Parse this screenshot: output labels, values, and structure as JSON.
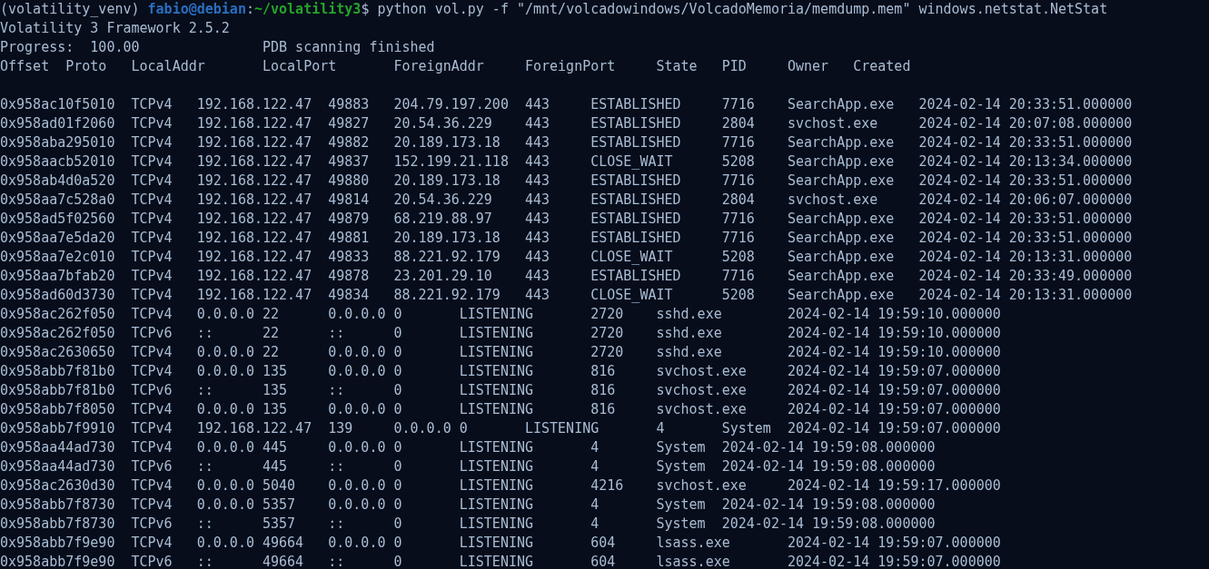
{
  "prompt": {
    "venv": "(volatility_venv)",
    "user_host": "fabio@debian",
    "separator": ":",
    "path": "~/volatility3",
    "command": "$ python vol.py -f \"/mnt/volcadowindows/VolcadoMemoria/memdump.mem\" windows.netstat.NetStat"
  },
  "output_lines": [
    {
      "text": "Volatility 3 Framework 2.5.2"
    },
    {
      "text": "Progress:  100.00\t\tPDB scanning finished"
    }
  ],
  "header_words": [
    "Offset",
    "Proto",
    "LocalAddr",
    "LocalPort",
    "ForeignAddr",
    "ForeignPort",
    "State",
    "PID",
    "Owner",
    "Created"
  ],
  "netstat": {
    "rows": [
      [
        "0x958ac10f5010",
        "TCPv4",
        "192.168.122.47",
        "49883",
        "204.79.197.200",
        "443",
        "ESTABLISHED",
        "7716",
        "SearchApp.exe",
        "2024-02-14 20:33:51.000000"
      ],
      [
        "0x958ad01f2060",
        "TCPv4",
        "192.168.122.47",
        "49827",
        "20.54.36.229",
        "443",
        "ESTABLISHED",
        "2804",
        "svchost.exe",
        "2024-02-14 20:07:08.000000"
      ],
      [
        "0x958aba295010",
        "TCPv4",
        "192.168.122.47",
        "49882",
        "20.189.173.18",
        "443",
        "ESTABLISHED",
        "7716",
        "SearchApp.exe",
        "2024-02-14 20:33:51.000000"
      ],
      [
        "0x958aacb52010",
        "TCPv4",
        "192.168.122.47",
        "49837",
        "152.199.21.118",
        "443",
        "CLOSE_WAIT",
        "5208",
        "SearchApp.exe",
        "2024-02-14 20:13:34.000000"
      ],
      [
        "0x958ab4d0a520",
        "TCPv4",
        "192.168.122.47",
        "49880",
        "20.189.173.18",
        "443",
        "ESTABLISHED",
        "7716",
        "SearchApp.exe",
        "2024-02-14 20:33:51.000000"
      ],
      [
        "0x958aa7c528a0",
        "TCPv4",
        "192.168.122.47",
        "49814",
        "20.54.36.229",
        "443",
        "ESTABLISHED",
        "2804",
        "svchost.exe",
        "2024-02-14 20:06:07.000000"
      ],
      [
        "0x958ad5f02560",
        "TCPv4",
        "192.168.122.47",
        "49879",
        "68.219.88.97",
        "443",
        "ESTABLISHED",
        "7716",
        "SearchApp.exe",
        "2024-02-14 20:33:51.000000"
      ],
      [
        "0x958aa7e5da20",
        "TCPv4",
        "192.168.122.47",
        "49881",
        "20.189.173.18",
        "443",
        "ESTABLISHED",
        "7716",
        "SearchApp.exe",
        "2024-02-14 20:33:51.000000"
      ],
      [
        "0x958aa7e2c010",
        "TCPv4",
        "192.168.122.47",
        "49833",
        "88.221.92.179",
        "443",
        "CLOSE_WAIT",
        "5208",
        "SearchApp.exe",
        "2024-02-14 20:13:31.000000"
      ],
      [
        "0x958aa7bfab20",
        "TCPv4",
        "192.168.122.47",
        "49878",
        "23.201.29.10",
        "443",
        "ESTABLISHED",
        "7716",
        "SearchApp.exe",
        "2024-02-14 20:33:49.000000"
      ],
      [
        "0x958ad60d3730",
        "TCPv4",
        "192.168.122.47",
        "49834",
        "88.221.92.179",
        "443",
        "CLOSE_WAIT",
        "5208",
        "SearchApp.exe",
        "2024-02-14 20:13:31.000000"
      ],
      [
        "0x958ac262f050",
        "TCPv4",
        "0.0.0.0",
        "22",
        "0.0.0.0",
        "0",
        "LISTENING",
        "2720",
        "sshd.exe",
        "2024-02-14 19:59:10.000000"
      ],
      [
        "0x958ac262f050",
        "TCPv6",
        "::",
        "22",
        "::",
        "0",
        "LISTENING",
        "2720",
        "sshd.exe",
        "2024-02-14 19:59:10.000000"
      ],
      [
        "0x958ac2630650",
        "TCPv4",
        "0.0.0.0",
        "22",
        "0.0.0.0",
        "0",
        "LISTENING",
        "2720",
        "sshd.exe",
        "2024-02-14 19:59:10.000000"
      ],
      [
        "0x958abb7f81b0",
        "TCPv4",
        "0.0.0.0",
        "135",
        "0.0.0.0",
        "0",
        "LISTENING",
        "816",
        "svchost.exe",
        "2024-02-14 19:59:07.000000"
      ],
      [
        "0x958abb7f81b0",
        "TCPv6",
        "::",
        "135",
        "::",
        "0",
        "LISTENING",
        "816",
        "svchost.exe",
        "2024-02-14 19:59:07.000000"
      ],
      [
        "0x958abb7f8050",
        "TCPv4",
        "0.0.0.0",
        "135",
        "0.0.0.0",
        "0",
        "LISTENING",
        "816",
        "svchost.exe",
        "2024-02-14 19:59:07.000000"
      ],
      [
        "0x958abb7f9910",
        "TCPv4",
        "192.168.122.47",
        "139",
        "0.0.0.0",
        "0",
        "LISTENING",
        "4",
        "System",
        "2024-02-14 19:59:07.000000"
      ],
      [
        "0x958aa44ad730",
        "TCPv4",
        "0.0.0.0",
        "445",
        "0.0.0.0",
        "0",
        "LISTENING",
        "4",
        "System",
        "2024-02-14 19:59:08.000000"
      ],
      [
        "0x958aa44ad730",
        "TCPv6",
        "::",
        "445",
        "::",
        "0",
        "LISTENING",
        "4",
        "System",
        "2024-02-14 19:59:08.000000"
      ],
      [
        "0x958ac2630d30",
        "TCPv4",
        "0.0.0.0",
        "5040",
        "0.0.0.0",
        "0",
        "LISTENING",
        "4216",
        "svchost.exe",
        "2024-02-14 19:59:17.000000"
      ],
      [
        "0x958abb7f8730",
        "TCPv4",
        "0.0.0.0",
        "5357",
        "0.0.0.0",
        "0",
        "LISTENING",
        "4",
        "System",
        "2024-02-14 19:59:08.000000"
      ],
      [
        "0x958abb7f8730",
        "TCPv6",
        "::",
        "5357",
        "::",
        "0",
        "LISTENING",
        "4",
        "System",
        "2024-02-14 19:59:08.000000"
      ],
      [
        "0x958abb7f9e90",
        "TCPv4",
        "0.0.0.0",
        "49664",
        "0.0.0.0",
        "0",
        "LISTENING",
        "604",
        "lsass.exe",
        "2024-02-14 19:59:07.000000"
      ],
      [
        "0x958abb7f9e90",
        "TCPv6",
        "::",
        "49664",
        "::",
        "0",
        "LISTENING",
        "604",
        "lsass.exe",
        "2024-02-14 19:59:07.000000"
      ]
    ]
  }
}
